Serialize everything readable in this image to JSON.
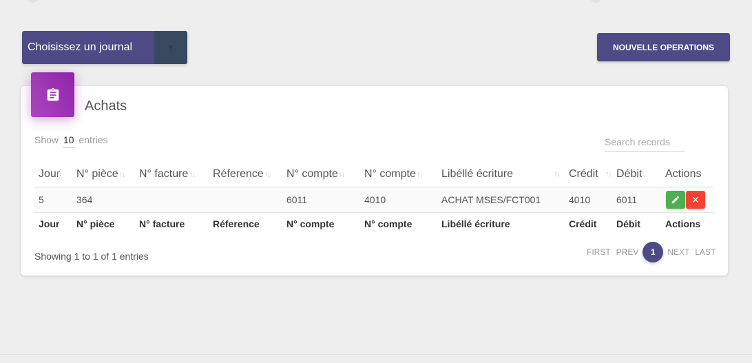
{
  "journal_select": {
    "label": "Choisissez un journal"
  },
  "new_operation_button": {
    "label": "NOUVELLE OPERATIONS"
  },
  "card": {
    "title": "Achats",
    "icon": "clipboard-icon",
    "icon_color": "#9c27b0"
  },
  "length": {
    "prefix": "Show",
    "value": "10",
    "suffix": "entries"
  },
  "search": {
    "placeholder": "Search records"
  },
  "columns": [
    "Jour",
    "N° pièce",
    "N° facture",
    "Réference",
    "N° compte",
    "N° compte",
    "Libéllé écriture",
    "Crédit",
    "Débit",
    "Actions"
  ],
  "rows": [
    {
      "jour": "5",
      "piece": "364",
      "facture": "",
      "reference": "",
      "compte1": "6011",
      "compte2": "4010",
      "libelle": "ACHAT MSES/FCT001",
      "credit": "4010",
      "debit": "6011"
    }
  ],
  "footer_columns": [
    "Jour",
    "N° pièce",
    "N° facture",
    "Réference",
    "N° compte",
    "N° compte",
    "Libéllé écriture",
    "Crédit",
    "Débit",
    "Actions"
  ],
  "info": "Showing 1 to 1 of 1 entries",
  "pagination": {
    "first": "FIRST",
    "prev": "PREV",
    "current": "1",
    "next": "NEXT",
    "last": "LAST"
  },
  "colors": {
    "primary": "#4d4a86",
    "edit": "#4caf50",
    "delete": "#f44336"
  }
}
